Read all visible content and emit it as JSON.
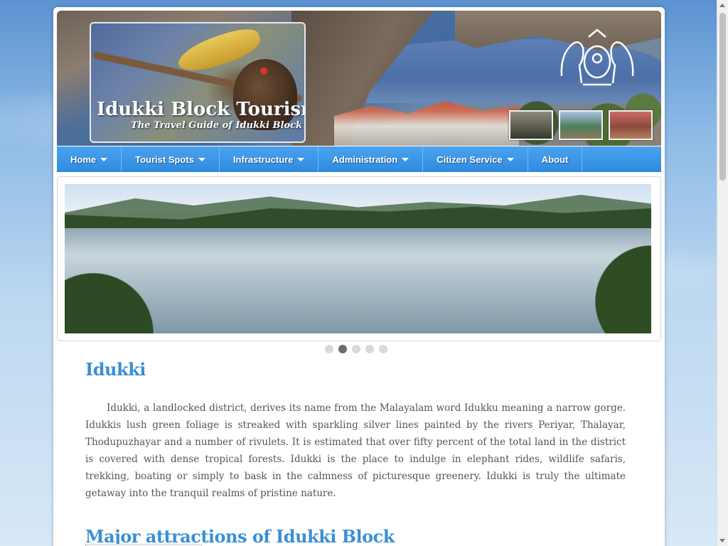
{
  "site": {
    "title": "Idukki Block Tourism",
    "tagline": "The Travel Guide of Idukki Block"
  },
  "nav": {
    "items": [
      {
        "label": "Home",
        "has_dropdown": true
      },
      {
        "label": "Tourist Spots",
        "has_dropdown": true
      },
      {
        "label": "Infrastructure",
        "has_dropdown": true
      },
      {
        "label": "Administration",
        "has_dropdown": true
      },
      {
        "label": "Citizen Service",
        "has_dropdown": true
      },
      {
        "label": "About",
        "has_dropdown": false
      }
    ]
  },
  "slider": {
    "slide_count": 5,
    "active_index": 1
  },
  "main": {
    "heading": "Idukki",
    "paragraph": "Idukki, a landlocked district, derives its name from the Malayalam word Idukku meaning a narrow gorge. Idukkis lush green foliage is streaked with sparkling silver lines painted by the rivers Periyar, Thalayar, Thodupuzhayar and a number of rivulets. It is estimated that over fifty percent of the total land in the district is covered with dense tropical forests. Idukki is the place to indulge in elephant rides, wildlife safaris, trekking, boating or simply to bask in the calmness of picturesque greenery. Idukki is truly the ultimate getaway into the tranquil realms of pristine nature.",
    "attractions_heading": "Major attractions of Idukki Block"
  },
  "colors": {
    "nav_bg": "#3596e6",
    "heading": "#3a8fd6",
    "body_text": "#555555"
  }
}
